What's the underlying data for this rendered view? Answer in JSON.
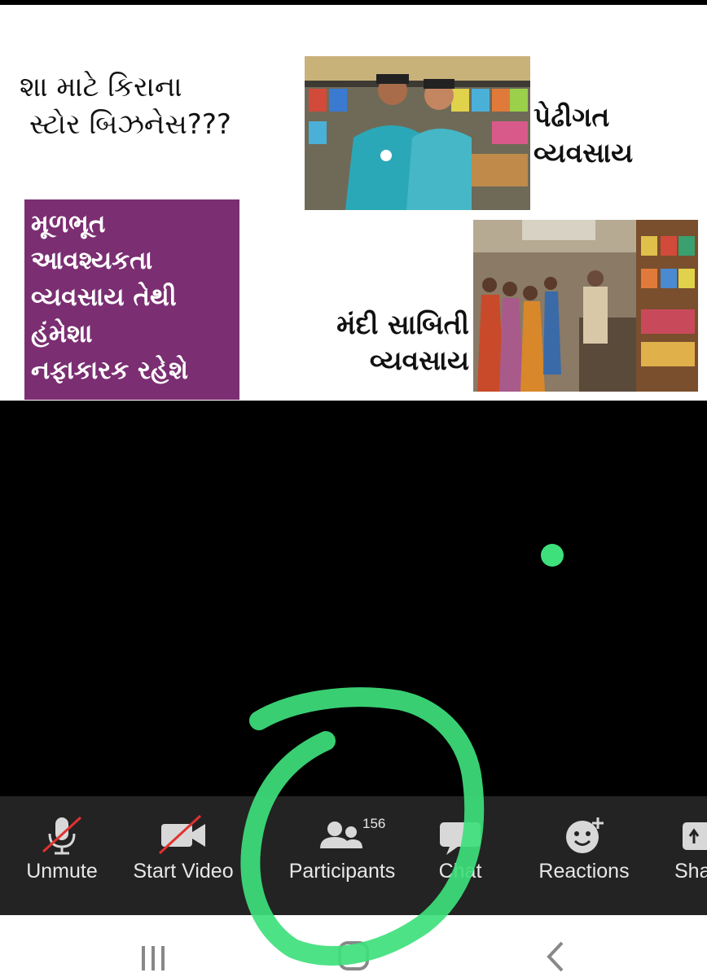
{
  "slide": {
    "title_line1": "શા માટે કિરાના",
    "title_line2": "સ્ટોર બિઝનેસ???",
    "callout_right": [
      "પેઢીગત",
      "વ્યવસાય"
    ],
    "callout_center": [
      "મંદી સાબિતી",
      "વ્યવસાય"
    ],
    "purple_box": [
      "મૂળભૂત",
      "આવશ્યકતા",
      "વ્યવસાય તેથી",
      "હંમેશા",
      "નફાકારક રહેશે"
    ],
    "colors": {
      "purple": "#7b2e72",
      "background": "#ffffff"
    }
  },
  "toolbar": {
    "unmute_label": "Unmute",
    "start_video_label": "Start Video",
    "participants_label": "Participants",
    "participants_count": "156",
    "chat_label": "Chat",
    "reactions_label": "Reactions",
    "share_label": "Share"
  },
  "colors": {
    "annotation_green": "#3ee07c",
    "toolbar_bg": "#232323",
    "muted_red": "#e0322f"
  }
}
